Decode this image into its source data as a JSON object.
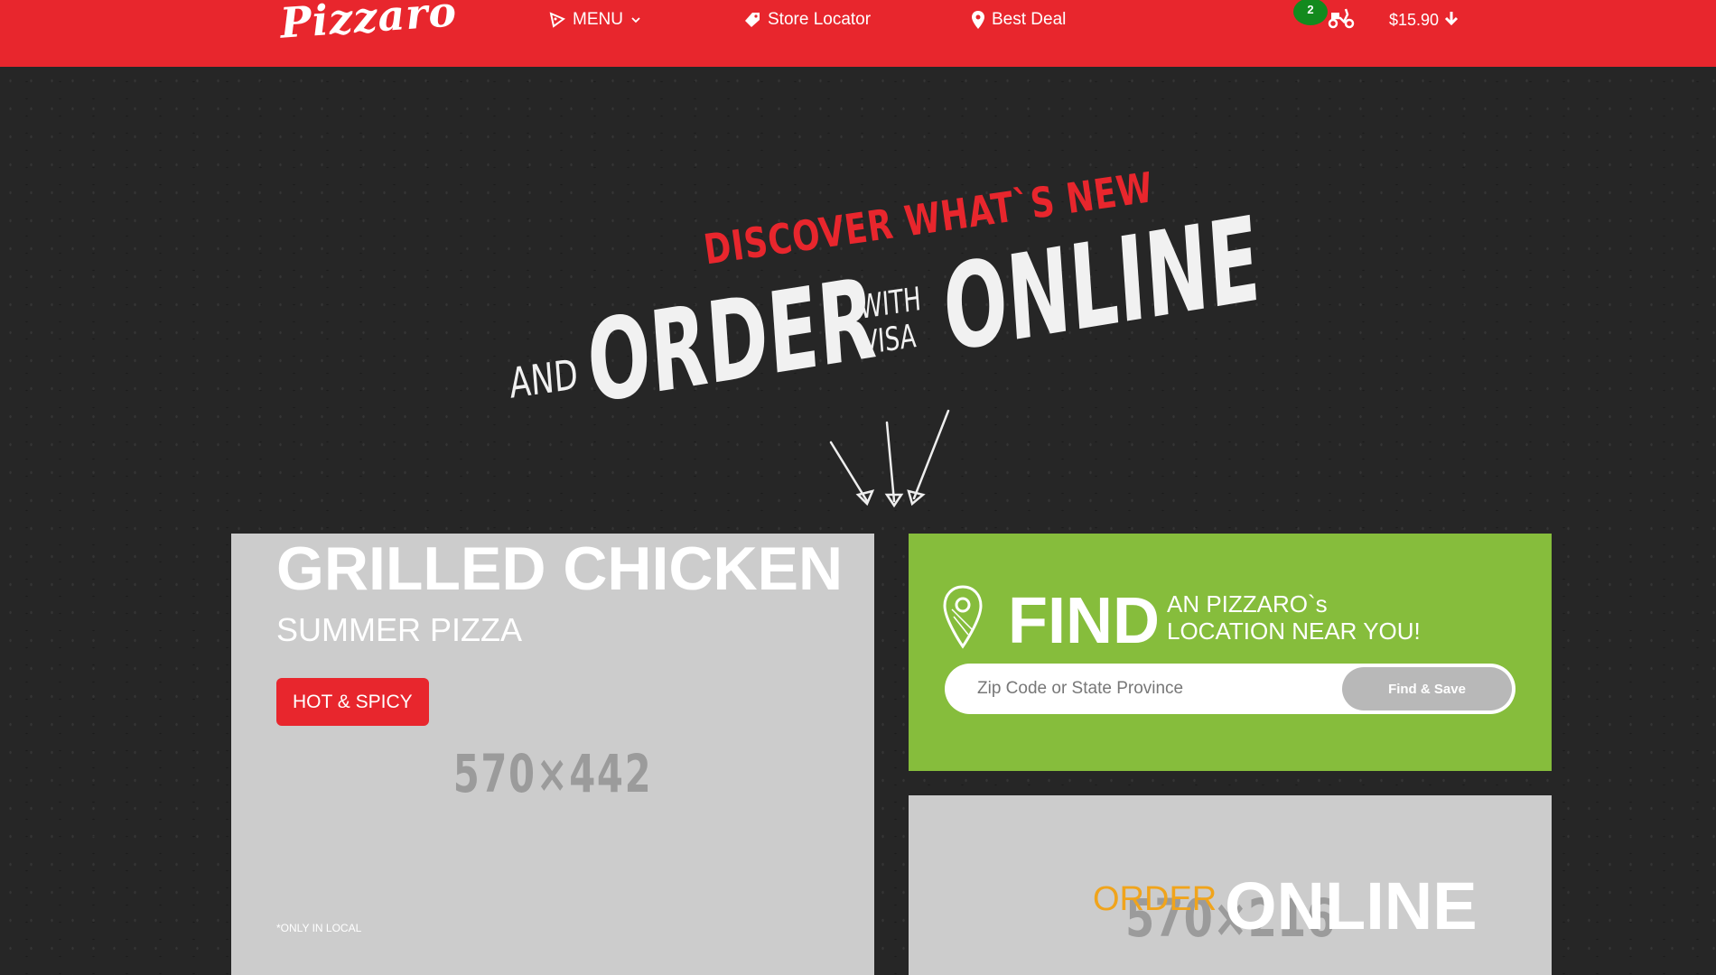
{
  "header": {
    "logo": "Pizzaro",
    "nav": [
      {
        "label": "MENU",
        "icon": "pizza-slice-icon"
      },
      {
        "label": "Store Locator",
        "icon": "tag-icon"
      },
      {
        "label": "Best Deal",
        "icon": "map-pin-icon"
      }
    ],
    "cart_count": "2",
    "cart_total": "$15.90"
  },
  "hero": {
    "discover": "DISCOVER WHAT`S NEW",
    "and": "AND",
    "order": "ORDER",
    "with_visa": "WITH VISA",
    "online": "ONLINE"
  },
  "promo": {
    "placeholder": "570×442",
    "title": "GRILLED CHICKEN",
    "subtitle": "SUMMER PIZZA",
    "tag": "HOT & SPICY",
    "note": "*ONLY IN LOCAL"
  },
  "finder": {
    "heading": "FIND",
    "subheading_line1": "AN PIZZARO`s",
    "subheading_line2": "LOCATION NEAR YOU!",
    "input_placeholder": "Zip Code or State Province",
    "button": "Find & Save"
  },
  "order_card": {
    "placeholder": "570×216",
    "order": "ORDER",
    "online": "ONLINE"
  },
  "colors": {
    "brand_red": "#e8262d",
    "finder_green": "#86bd3c",
    "badge_green": "#138a1e",
    "order_orange": "#f0a41c",
    "placeholder_gray": "#cccccc"
  }
}
